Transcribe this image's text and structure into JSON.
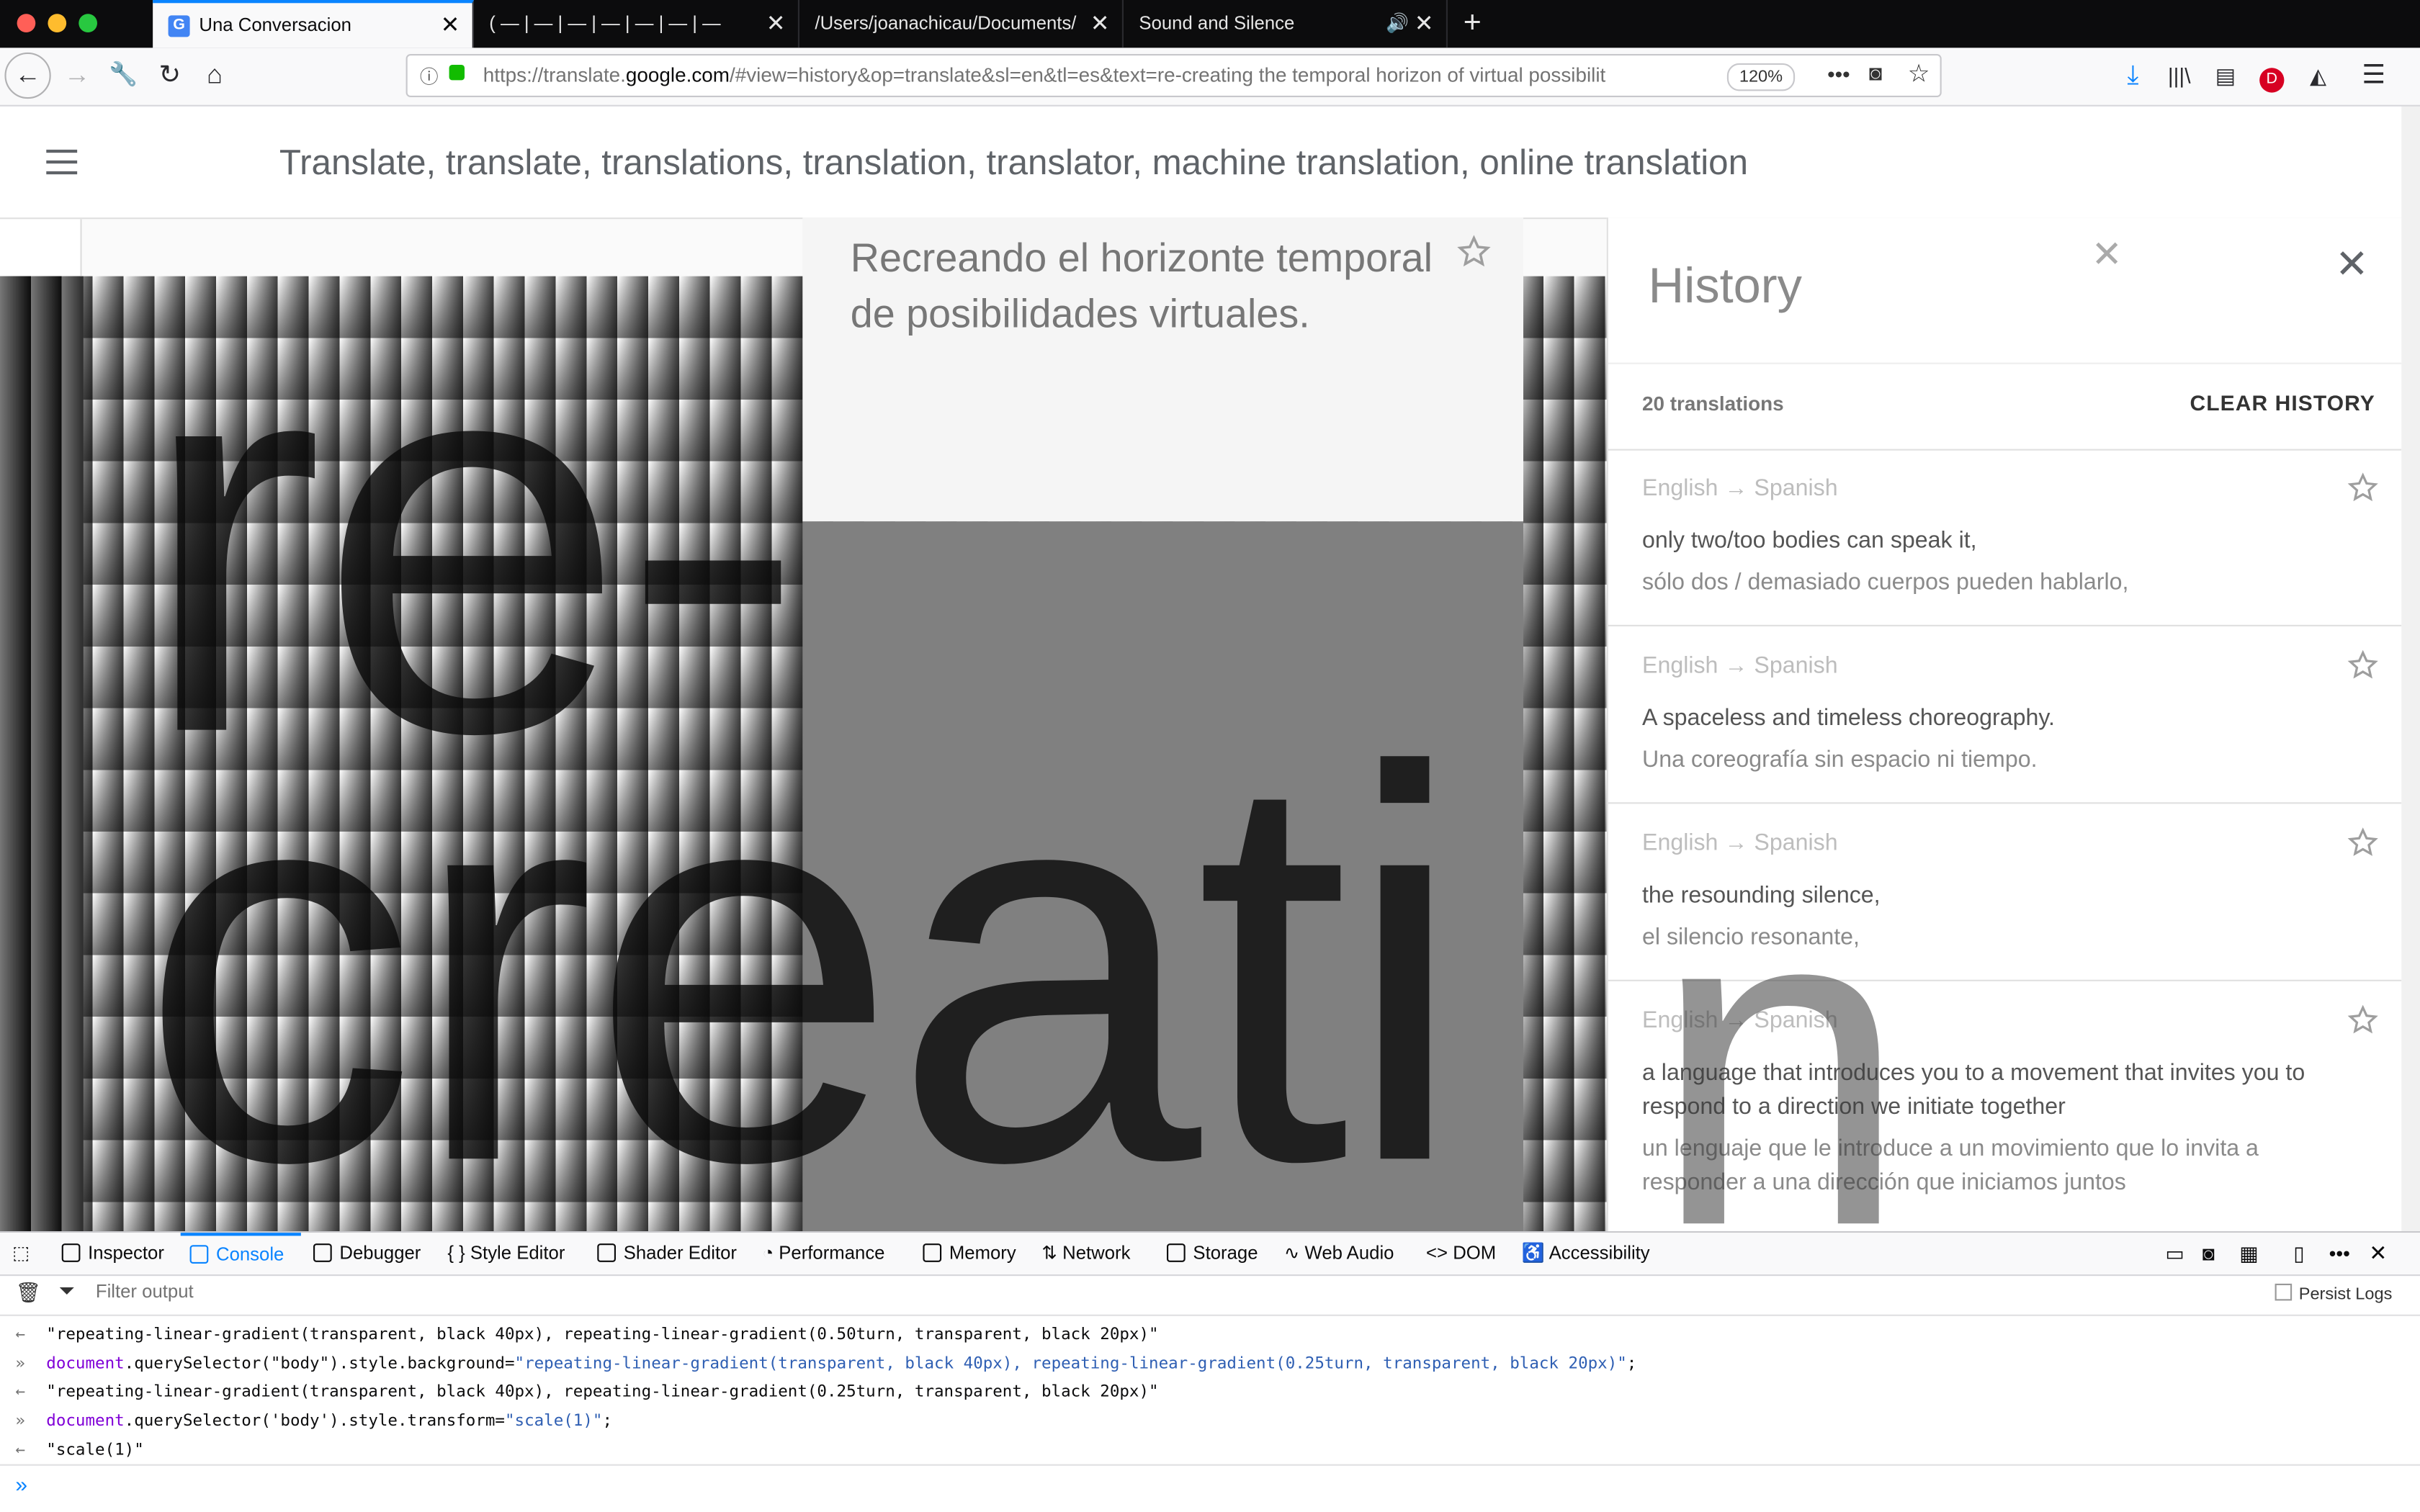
{
  "browser": {
    "tabs": [
      {
        "label": "Una Conversacion",
        "active": true
      },
      {
        "label": "( — | — | — | — | — | — | — )",
        "active": false
      },
      {
        "label": "/Users/joanachicau/Documents/Pro",
        "active": false
      },
      {
        "label": "Sound and Silence",
        "active": false
      }
    ],
    "tab_close": "✕",
    "new_tab": "+",
    "url_prefix": "https://translate.",
    "url_domain": "google.com",
    "url_rest": "/#view=history&op=translate&sl=en&tl=es&text=re-creating the temporal horizon of virtual possibilit",
    "zoom": "120%"
  },
  "page": {
    "header_title": "Translate, translate, translations, translation, translator, machine translation, online translation",
    "output_text": "Recreando el horizonte temporal de posibilidades virtuales.",
    "big_text_line1": "re-",
    "big_text_line2": "creati",
    "ghost_letter": "n"
  },
  "history": {
    "title": "History",
    "count": "20 translations",
    "clear": "CLEAR HISTORY",
    "items": [
      {
        "lang": "English → Spanish",
        "src": "only two/too bodies can speak it,",
        "tgt": "sólo dos / demasiado cuerpos pueden hablarlo,"
      },
      {
        "lang": "English → Spanish",
        "src": "A spaceless and timeless choreography.",
        "tgt": "Una coreografía sin espacio ni tiempo."
      },
      {
        "lang": "English → Spanish",
        "src": "the resounding silence,",
        "tgt": "el silencio resonante,"
      },
      {
        "lang": "English → Spanish",
        "src": "a language that introduces you to a movement that invites you to respond to a direction we initiate together",
        "tgt": "un lenguaje que le introduce a un movimiento que lo invita a responder a una dirección que iniciamos juntos"
      }
    ]
  },
  "devtools": {
    "tabs": [
      "Inspector",
      "Console",
      "Debugger",
      "Style Editor",
      "Shader Editor",
      "Performance",
      "Memory",
      "Network",
      "Storage",
      "Web Audio",
      "DOM",
      "Accessibility"
    ],
    "filter_placeholder": "Filter output",
    "persist_logs": "Persist Logs",
    "lines": {
      "l1": "\"repeating-linear-gradient(transparent, black 40px), repeating-linear-gradient(0.50turn, transparent, black 20px)\"",
      "l2_a": "document",
      "l2_b": ".querySelector(\"body\").style.background=",
      "l2_c": "\"repeating-linear-gradient(transparent, black 40px), repeating-linear-gradient(0.25turn, transparent, black 20px)\"",
      "l2_d": ";",
      "l3": "\"repeating-linear-gradient(transparent, black 40px), repeating-linear-gradient(0.25turn, transparent, black 20px)\"",
      "l4_a": "document",
      "l4_b": ".querySelector('body').style.transform=",
      "l4_c": "\"scale(1)\"",
      "l4_d": ";",
      "l5": "\"scale(1)\""
    }
  }
}
